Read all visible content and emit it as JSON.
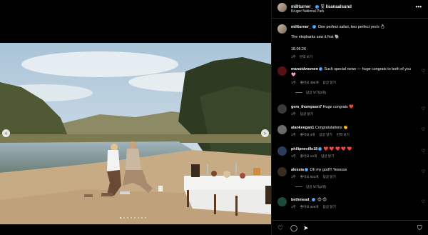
{
  "post": {
    "author": "millturner_",
    "separator": "및",
    "coauthor": "lisanaalsund",
    "location": "Kruger National Park",
    "more_icon": "more-horizontal-icon"
  },
  "caption": {
    "username": "millturner_",
    "text": "One perfect safari, two perfect yes's 💍",
    "line2": "The elephants saw it first 🐘",
    "date": "18.06.26",
    "meta_time": "1주",
    "meta_translate": "번역 보기"
  },
  "comments": [
    {
      "username": "manutdwomen",
      "verified": true,
      "text": "Such special news — huge congrats to both of you 🩷",
      "time": "1주",
      "likes": "좋아요 495개",
      "reply": "답글 달기",
      "view_replies": "답글 보기(2개)"
    },
    {
      "username": "gem_thompson7",
      "verified": false,
      "text": "Huge congrats ❤️",
      "time": "1주",
      "likes": "",
      "reply": "답글 달기",
      "view_replies": ""
    },
    {
      "username": "alankeegan1",
      "verified": false,
      "text": "Congratulations 👏",
      "time": "1주",
      "likes": "좋아요 4개",
      "reply": "답글 달기",
      "translate": "번역 보기",
      "view_replies": ""
    },
    {
      "username": "philipneville18",
      "verified": true,
      "text": "❤️ ❤️ ❤️ ❤️ ❤️",
      "time": "1주",
      "likes": "좋아요 13개",
      "reply": "답글 달기",
      "view_replies": ""
    },
    {
      "username": "alessia",
      "verified": true,
      "text": "Oh my god!!! Yesssss",
      "time": "1주",
      "likes": "좋아요 923개",
      "reply": "답글 달기",
      "view_replies": "답글 보기(2개)"
    },
    {
      "username": "bethmead_",
      "verified": true,
      "text": "😍 😍",
      "time": "1주",
      "likes": "좋아요 346개",
      "reply": "답글 달기",
      "view_replies": ""
    }
  ],
  "media": {
    "prev_label": "‹",
    "next_label": "›",
    "slide_count": 8,
    "active_slide": 1
  },
  "actions": {
    "like_icon": "heart-icon",
    "comment_icon": "comment-icon",
    "share_icon": "share-icon",
    "save_icon": "bookmark-icon"
  },
  "colors": {
    "verified": "#3897f0",
    "heart_red": "#ed4956",
    "panel_bg": "#000000",
    "muted_text": "#a8a8a8"
  }
}
